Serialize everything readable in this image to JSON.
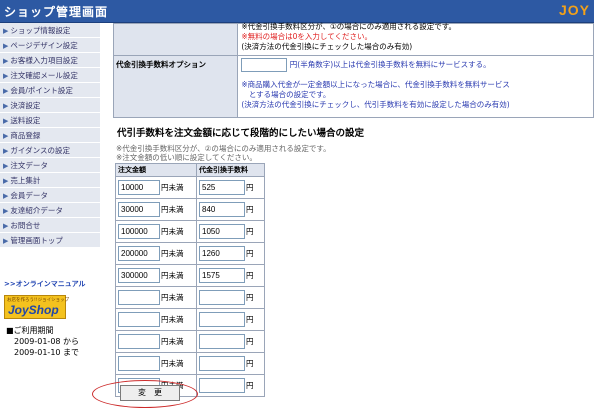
{
  "window": {
    "title": "ショップ管理画面",
    "brand": "JOY"
  },
  "sidebar": {
    "items": [
      {
        "label": "ショップ情報設定"
      },
      {
        "label": "ページデザイン設定"
      },
      {
        "label": "お客様入力項目設定"
      },
      {
        "label": "注文確認メール設定"
      },
      {
        "label": "会員/ポイント設定"
      },
      {
        "label": "決済設定"
      },
      {
        "label": "送料設定"
      },
      {
        "label": "商品登録"
      },
      {
        "label": "ガイダンスの設定"
      },
      {
        "label": "注文データ"
      },
      {
        "label": "売上集計"
      },
      {
        "label": "会員データ"
      },
      {
        "label": "友達紹介データ"
      },
      {
        "label": "お問合せ"
      },
      {
        "label": "管理画面トップ"
      }
    ],
    "manual_link": ">>オンラインマニュアル",
    "logo": {
      "small": "お店を作ろう!!ジョイショップ",
      "big": "JoyShop"
    },
    "period": {
      "heading": "■ご利用期間",
      "from": "2009-01-08 から",
      "to": "2009-01-10 まで"
    }
  },
  "options": {
    "row1": {
      "line1": "※代金引換手数料区分が、①の場合にのみ適用される設定です。",
      "line2_red": "※無料の場合は0を入力してください。",
      "line3": "(決済方法の代金引換にチェックした場合のみ有効)"
    },
    "row2": {
      "label": "代金引換手数料オプション",
      "input_value": "",
      "suffix": "円(半角数字)以上は代金引換手数料を無料にサービスする。",
      "note1": "※商品購入代金が一定金額以上になった場合に、代金引換手数料を無料サービス",
      "note2": "　とする場合の設定です。",
      "note3": "(決済方法の代金引換にチェックし、代引手数料を有効に設定した場合のみ有効)"
    }
  },
  "tiered": {
    "title": "代引手数料を注文金額に応じて段階的にしたい場合の設定",
    "note1": "※代金引換手数料区分が、②の場合にのみ適用される設定です。",
    "note2": "※注文金額の低い順に設定してください。",
    "col_amount": "注文金額",
    "col_fee": "代金引換手数料",
    "amount_unit": "円未満",
    "fee_unit": "円",
    "rows": [
      {
        "amount": "10000",
        "fee": "525"
      },
      {
        "amount": "30000",
        "fee": "840"
      },
      {
        "amount": "100000",
        "fee": "1050"
      },
      {
        "amount": "200000",
        "fee": "1260"
      },
      {
        "amount": "300000",
        "fee": "1575"
      },
      {
        "amount": "",
        "fee": ""
      },
      {
        "amount": "",
        "fee": ""
      },
      {
        "amount": "",
        "fee": ""
      },
      {
        "amount": "",
        "fee": ""
      },
      {
        "amount": "",
        "fee": ""
      }
    ]
  },
  "submit_label": "変　更",
  "colors": {
    "titlebar": "#2d59a3",
    "brand": "#f2a11a",
    "menu_bg": "#e4e8f0",
    "annotation": "#cc2a2a",
    "error": "#e02020"
  }
}
